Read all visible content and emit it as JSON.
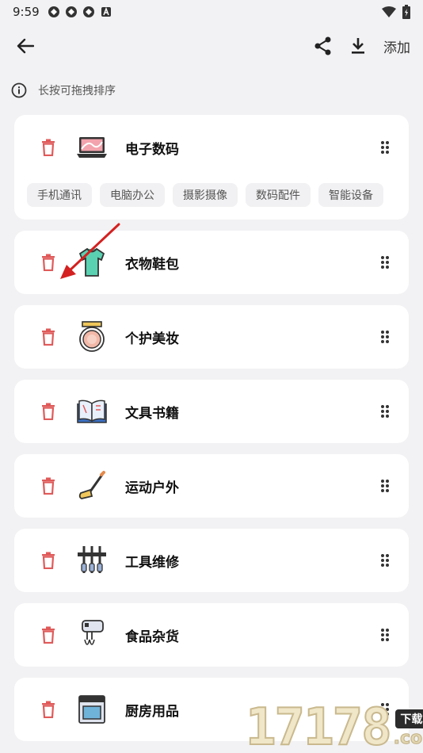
{
  "status_bar": {
    "time": "9:59"
  },
  "app_bar": {
    "add_label": "添加"
  },
  "hint": {
    "text": "长按可拖拽排序"
  },
  "categories": [
    {
      "name": "电子数码",
      "tags": [
        "手机通讯",
        "电脑办公",
        "摄影摄像",
        "数码配件",
        "智能设备"
      ]
    },
    {
      "name": "衣物鞋包"
    },
    {
      "name": "个护美妆"
    },
    {
      "name": "文具书籍"
    },
    {
      "name": "运动户外"
    },
    {
      "name": "工具维修"
    },
    {
      "name": "食品杂货"
    },
    {
      "name": "厨房用品"
    }
  ],
  "watermark": {
    "number": "17178",
    "tag": "下载站",
    "domain": ".com"
  },
  "colors": {
    "delete": "#e05a5a",
    "arrow": "#d42020",
    "card": "#ffffff",
    "background": "#f2f2f4"
  }
}
